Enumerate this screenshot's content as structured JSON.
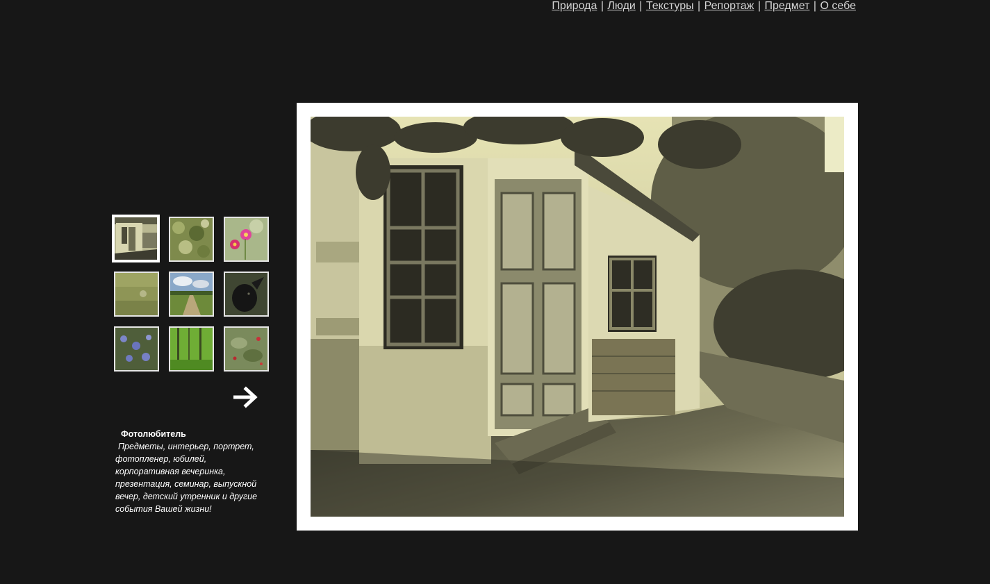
{
  "nav": {
    "items": [
      {
        "label": "Природа"
      },
      {
        "label": "Люди"
      },
      {
        "label": "Текстуры"
      },
      {
        "label": "Репортаж"
      },
      {
        "label": "Предмет"
      },
      {
        "label": "О себе"
      }
    ],
    "separator": "|"
  },
  "thumbnails": [
    {
      "name": "old-house",
      "active": true
    },
    {
      "name": "leaves",
      "active": false
    },
    {
      "name": "pink-flowers",
      "active": false
    },
    {
      "name": "grass",
      "active": false
    },
    {
      "name": "field-road",
      "active": false
    },
    {
      "name": "black-goat",
      "active": false
    },
    {
      "name": "blue-flowers",
      "active": false
    },
    {
      "name": "green-forest",
      "active": false
    },
    {
      "name": "red-berries",
      "active": false
    }
  ],
  "next_icon": "arrow-right-icon",
  "about": {
    "title": "Фотолюбитель",
    "description": "Предметы, интерьер, портрет, фотопленер, юбилей, корпоративная вечеринка, презентация, семинар, выпускной вечер, детский утренник и другие события Вашей жизни!"
  },
  "colors": {
    "background": "#171717",
    "frame": "#ffffff",
    "link": "#d4d4d4"
  }
}
